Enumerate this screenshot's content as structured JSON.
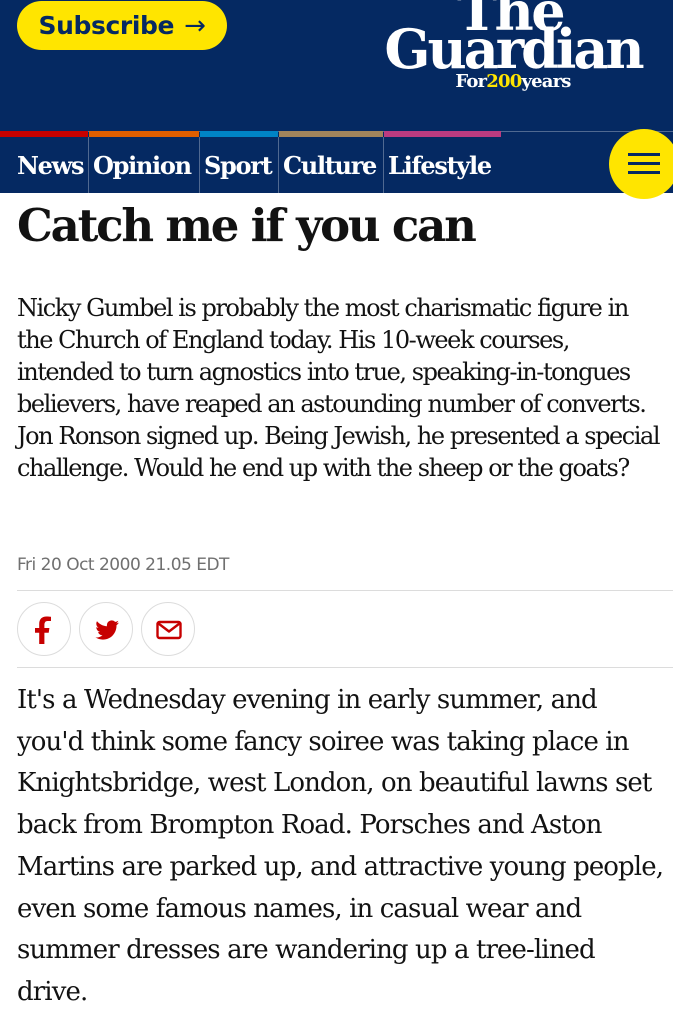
{
  "header": {
    "subscribe_label": "Subscribe",
    "subscribe_arrow": "→",
    "logo_the": "The",
    "logo_guardian": "Guardian",
    "tagline_prefix": "For",
    "tagline_number": "200",
    "tagline_suffix": "years",
    "nav": [
      {
        "label": "News",
        "color": "#c70000"
      },
      {
        "label": "Opinion",
        "color": "#e05e00"
      },
      {
        "label": "Sport",
        "color": "#0084c6"
      },
      {
        "label": "Culture",
        "color": "#a1845c"
      },
      {
        "label": "Lifestyle",
        "color": "#bb3b80"
      }
    ],
    "menu_icon": "hamburger-icon"
  },
  "colors": {
    "brand_blue": "#052962",
    "accent_yellow": "#ffe500",
    "news_red": "#c70000"
  },
  "article": {
    "headline": "Catch me if you can",
    "standfirst": "Nicky Gumbel is probably the most charismatic figure in the Church of England today. His 10-week courses, intended to turn agnostics into true, speaking-in-tongues believers, have reaped an astounding number of converts. Jon Ronson signed up. Being Jewish, he presented a special challenge. Would he end up with the sheep or the goats?",
    "dateline": "Fri 20 Oct 2000 21.05 EDT",
    "share_icons": [
      "facebook-icon",
      "twitter-icon",
      "email-icon"
    ],
    "body": "It's a Wednesday evening in early summer, and you'd think some fancy soiree was taking place in Knightsbridge, west London, on beautiful lawns set back from Brompton Road. Porsches and Aston Martins are parked up, and attractive young people, even some famous names, in casual wear and summer dresses are wandering up a tree-lined drive."
  }
}
